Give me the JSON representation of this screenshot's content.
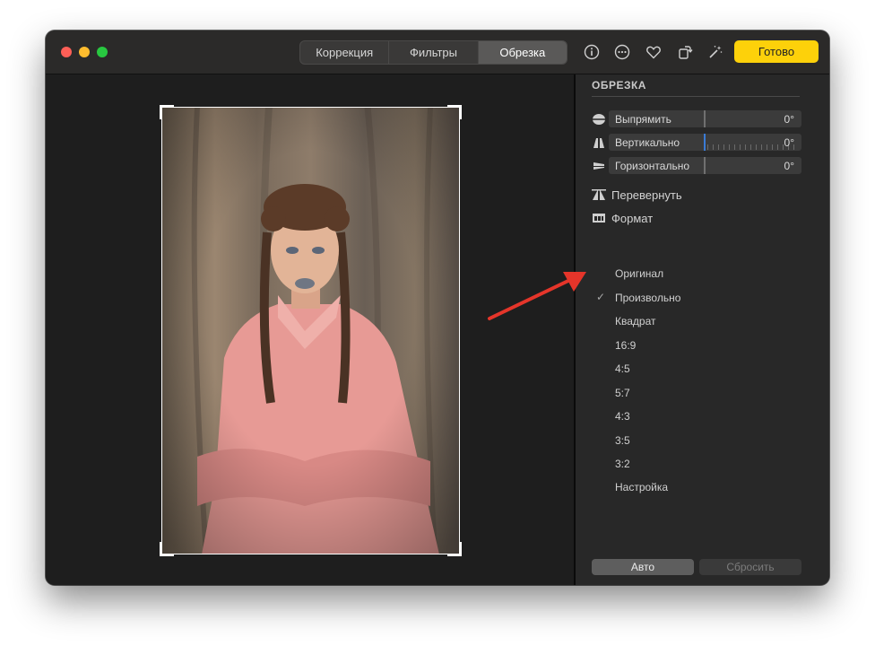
{
  "toolbar": {
    "tabs": [
      {
        "label": "Коррекция"
      },
      {
        "label": "Фильтры"
      },
      {
        "label": "Обрезка"
      }
    ],
    "active_tab": "Обрезка",
    "icons": [
      "info-icon",
      "more-icon",
      "heart-icon",
      "rotate-icon",
      "magic-wand-icon"
    ],
    "done_label": "Готово"
  },
  "sidebar": {
    "section_title": "ОБРЕЗКА",
    "sliders": [
      {
        "label": "Выпрямить",
        "value": "0°",
        "icon": "straighten-icon"
      },
      {
        "label": "Вертикально",
        "value": "0°",
        "icon": "vertical-icon"
      },
      {
        "label": "Горизонтально",
        "value": "0°",
        "icon": "horizontal-icon"
      }
    ],
    "flip_label": "Перевернуть",
    "format_label": "Формат",
    "formats": [
      "Оригинал",
      "Произвольно",
      "Квадрат",
      "16:9",
      "4:5",
      "5:7",
      "4:3",
      "3:5",
      "3:2",
      "Настройка"
    ],
    "selected_format": "Произвольно",
    "check_mark": "✓",
    "auto_label": "Авто",
    "reset_label": "Сбросить"
  },
  "colors": {
    "accent_yellow": "#fdd10a",
    "annotation_arrow": "#e5352a"
  }
}
